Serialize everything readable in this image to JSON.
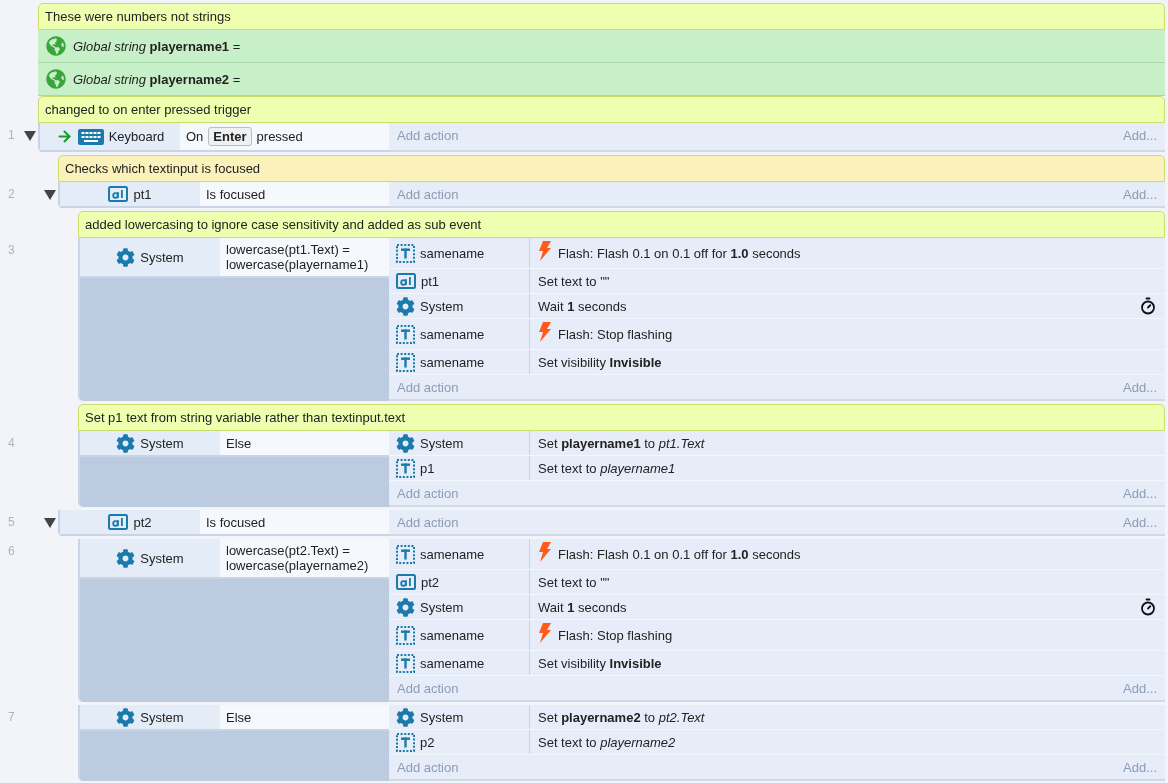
{
  "items": [
    {
      "kind": "comment",
      "color": "#eeffb0",
      "text": "These were numbers not strings"
    },
    {
      "kind": "global",
      "text": "*Global string* **playername1** ="
    },
    {
      "kind": "global",
      "text": "*Global string* **playername2** ="
    },
    {
      "kind": "comment",
      "color": "#eeffb0",
      "text": "changed to on enter pressed trigger"
    },
    {
      "kind": "event",
      "number": "1",
      "expanded": true,
      "add_action": "Add action",
      "add": "Add...",
      "conditions": [
        {
          "object": "Keyboard",
          "kind": "keyboard",
          "trigger": true,
          "text": "On",
          "key": "Enter",
          "text_after": "pressed"
        }
      ],
      "children": [
        {
          "kind": "comment",
          "color": "#fbf2bb",
          "text": "Checks which textinput is focused"
        },
        {
          "kind": "event",
          "number": "2",
          "expanded": true,
          "add_action": "Add action",
          "add": "Add...",
          "conditions": [
            {
              "object": "pt1",
              "kind": "textinput",
              "text": "Is focused"
            }
          ],
          "children": [
            {
              "kind": "comment",
              "color": "#eeffb0",
              "text": "added lowercasing to ignore case sensitivity and added as sub event"
            },
            {
              "kind": "event",
              "number": "3",
              "add_action": "Add action",
              "add": "Add...",
              "conditions": [
                {
                  "object": "System",
                  "kind": "system",
                  "text": "lowercase(pt1.Text) = lowercase(playername1)"
                }
              ],
              "actions": [
                {
                  "object": "samename",
                  "kind": "text",
                  "flash": true,
                  "text": "Flash: Flash 0.1 on 0.1 off for **1.0** seconds"
                },
                {
                  "object": "pt1",
                  "kind": "textinput",
                  "text": "Set text to \"\""
                },
                {
                  "object": "System",
                  "kind": "system",
                  "wait": true,
                  "text": "Wait **1** seconds"
                },
                {
                  "object": "samename",
                  "kind": "text",
                  "flash": true,
                  "text": "Flash: Stop flashing"
                },
                {
                  "object": "samename",
                  "kind": "text",
                  "text": "Set visibility **Invisible**"
                }
              ]
            },
            {
              "kind": "comment",
              "color": "#eeffb0",
              "text": "Set p1 text from string variable rather than textinput.text"
            },
            {
              "kind": "event",
              "number": "4",
              "add_action": "Add action",
              "add": "Add...",
              "conditions": [
                {
                  "object": "System",
                  "kind": "system",
                  "text": "Else"
                }
              ],
              "actions": [
                {
                  "object": "System",
                  "kind": "system",
                  "text": "Set **playername1** to *pt1.Text*"
                },
                {
                  "object": "p1",
                  "kind": "text",
                  "text": "Set text to *playername1*"
                }
              ]
            }
          ]
        },
        {
          "kind": "event",
          "number": "5",
          "expanded": true,
          "add_action": "Add action",
          "add": "Add...",
          "conditions": [
            {
              "object": "pt2",
              "kind": "textinput",
              "text": "Is focused"
            }
          ],
          "children": [
            {
              "kind": "event",
              "number": "6",
              "add_action": "Add action",
              "add": "Add...",
              "conditions": [
                {
                  "object": "System",
                  "kind": "system",
                  "text": "lowercase(pt2.Text) = lowercase(playername2)"
                }
              ],
              "actions": [
                {
                  "object": "samename",
                  "kind": "text",
                  "flash": true,
                  "text": "Flash: Flash 0.1 on 0.1 off for **1.0** seconds"
                },
                {
                  "object": "pt2",
                  "kind": "textinput",
                  "text": "Set text to \"\""
                },
                {
                  "object": "System",
                  "kind": "system",
                  "wait": true,
                  "text": "Wait **1** seconds"
                },
                {
                  "object": "samename",
                  "kind": "text",
                  "flash": true,
                  "text": "Flash: Stop flashing"
                },
                {
                  "object": "samename",
                  "kind": "text",
                  "text": "Set visibility **Invisible**"
                }
              ]
            },
            {
              "kind": "event",
              "number": "7",
              "add_action": "Add action",
              "add": "Add...",
              "conditions": [
                {
                  "object": "System",
                  "kind": "system",
                  "text": "Else"
                }
              ],
              "actions": [
                {
                  "object": "System",
                  "kind": "system",
                  "text": "Set **playername2** to *pt2.Text*"
                },
                {
                  "object": "p2",
                  "kind": "text",
                  "text": "Set text to *playername2*"
                }
              ]
            }
          ]
        }
      ]
    }
  ]
}
